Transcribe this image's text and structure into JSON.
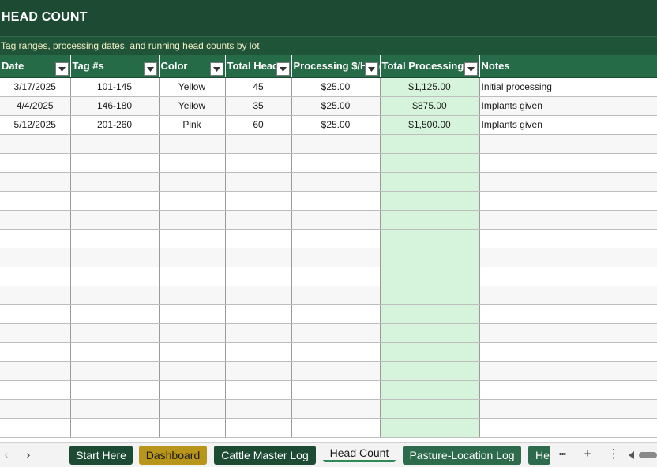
{
  "sheet": {
    "title": "HEAD COUNT",
    "subtitle": "Tag ranges, processing dates, and running head counts by lot"
  },
  "table": {
    "columns": [
      "Date",
      "Tag #s",
      "Color",
      "Total Head",
      "Processing $/Head",
      "Total Processing $",
      "Notes"
    ],
    "rows": [
      [
        "3/17/2025",
        "101-145",
        "Yellow",
        "45",
        "$25.00",
        "$1,125.00",
        "Initial processing"
      ],
      [
        "4/4/2025",
        "146-180",
        "Yellow",
        "35",
        "$25.00",
        "$875.00",
        "Implants given"
      ],
      [
        "5/12/2025",
        "201-260",
        "Pink",
        "60",
        "$25.00",
        "$1,500.00",
        "Implants given"
      ]
    ],
    "empty_rows": 16
  },
  "tabs": [
    {
      "label": "Start Here",
      "style": "dark"
    },
    {
      "label": "Dashboard",
      "style": "gold"
    },
    {
      "label": "Cattle Master Log",
      "style": "dark"
    },
    {
      "label": "Head Count",
      "style": "current"
    },
    {
      "label": "Pasture-Location Log",
      "style": "mid"
    },
    {
      "label": "He",
      "style": "mid"
    }
  ],
  "tabbar": {
    "prev_icon": "chevron-left-icon",
    "next_icon": "chevron-right-icon",
    "more_label": "•••",
    "add_label": "+",
    "options_label": "⋮"
  },
  "colors": {
    "title_bg": "#1d4a33",
    "header_bg": "#256b47",
    "calc_column_bg": "#d6f4db",
    "gold_tab": "#b8961c"
  }
}
